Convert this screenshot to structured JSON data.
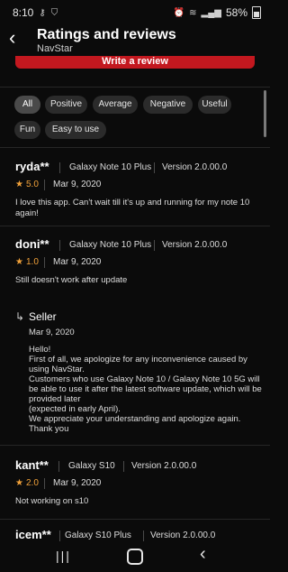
{
  "status": {
    "time": "8:10",
    "battery": "58%"
  },
  "header": {
    "title": "Ratings and reviews",
    "subtitle": "NavStar",
    "back_icon": "back-arrow-icon"
  },
  "write_review_label": "Write a review",
  "filters": [
    {
      "label": "All",
      "active": true
    },
    {
      "label": "Positive",
      "active": false
    },
    {
      "label": "Average",
      "active": false
    },
    {
      "label": "Negative",
      "active": false
    },
    {
      "label": "Useful",
      "active": false
    },
    {
      "label": "Fun",
      "active": false
    },
    {
      "label": "Easy to use",
      "active": false
    }
  ],
  "reviews": [
    {
      "name": "ryda**",
      "device": "Galaxy Note 10 Plus",
      "version": "Version 2.0.00.0",
      "rating": "5.0",
      "date": "Mar 9, 2020",
      "text": "I love this app.  Can't wait till it's up and running for my note 10 again!"
    },
    {
      "name": "doni**",
      "device": "Galaxy Note 10 Plus",
      "version": "Version 2.0.00.0",
      "rating": "1.0",
      "date": "Mar 9, 2020",
      "text": "Still doesn't work after update"
    },
    {
      "name": "kant**",
      "device": "Galaxy S10",
      "version": "Version 2.0.00.0",
      "rating": "2.0",
      "date": "Mar 9, 2020",
      "text": "Not working on s10"
    },
    {
      "name": "icem**",
      "device": "Galaxy S10 Plus",
      "version": "Version 2.0.00.0",
      "rating": "",
      "date": "",
      "text": ""
    }
  ],
  "seller": {
    "label": "Seller",
    "date": "Mar 9, 2020",
    "body": "Hello!\nFirst of all, we apologize for any inconvenience caused by using NavStar.\nCustomers who use Galaxy Note 10 / Galaxy Note 10 5G will be able to use it after the latest software update, which will be provided later\n(expected in early April).\nWe appreciate your understanding and apologize again.\nThank you"
  },
  "colors": {
    "accent": "#c3181f",
    "star": "#f2a23a",
    "background": "#0b0b0b"
  }
}
